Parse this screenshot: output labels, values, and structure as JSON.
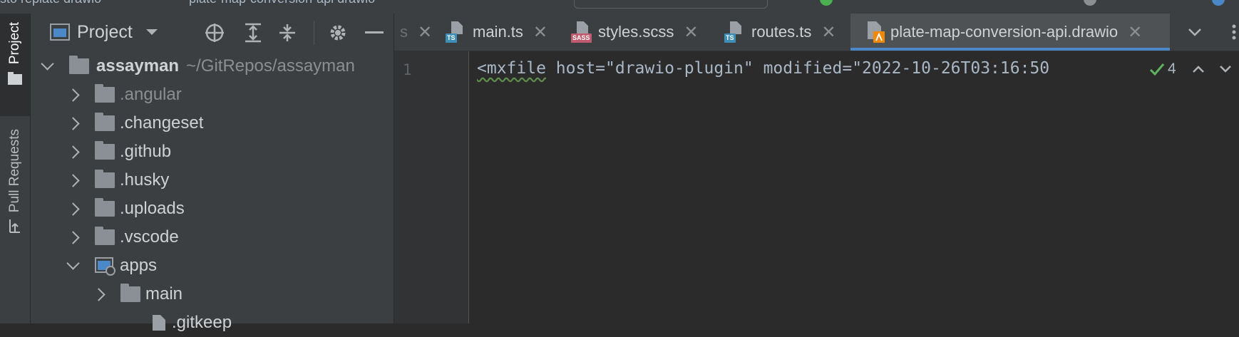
{
  "toolbar": {
    "crumbs": [
      "sto  replate drawio",
      "plate-map-conversion-api drawio"
    ]
  },
  "tool_strip": {
    "project": "Project",
    "pull_requests": "Pull Requests"
  },
  "project_panel": {
    "title": "Project",
    "tree": [
      {
        "label": "assayman",
        "hint": "~/GitRepos/assayman",
        "expanded": true,
        "depth": 0,
        "kind": "folder"
      },
      {
        "label": ".angular",
        "expanded": false,
        "depth": 1,
        "kind": "folder",
        "dim": true
      },
      {
        "label": ".changeset",
        "expanded": false,
        "depth": 1,
        "kind": "folder"
      },
      {
        "label": ".github",
        "expanded": false,
        "depth": 1,
        "kind": "folder"
      },
      {
        "label": ".husky",
        "expanded": false,
        "depth": 1,
        "kind": "folder"
      },
      {
        "label": ".uploads",
        "expanded": false,
        "depth": 1,
        "kind": "folder"
      },
      {
        "label": ".vscode",
        "expanded": false,
        "depth": 1,
        "kind": "folder"
      },
      {
        "label": "apps",
        "expanded": true,
        "depth": 1,
        "kind": "module"
      },
      {
        "label": "main",
        "expanded": false,
        "depth": 2,
        "kind": "folder"
      },
      {
        "label": ".gitkeep",
        "depth": 2,
        "kind": "file"
      }
    ]
  },
  "tabs": [
    {
      "label": "s",
      "type": "",
      "active": false
    },
    {
      "label": "main.ts",
      "type": "TS",
      "active": false
    },
    {
      "label": "styles.scss",
      "type": "SASS",
      "active": false
    },
    {
      "label": "routes.ts",
      "type": "TS",
      "active": false
    },
    {
      "label": "plate-map-conversion-api.drawio",
      "type": "drawio",
      "active": true
    }
  ],
  "editor": {
    "line_number": "1",
    "code_tag": "<mxfile",
    "code_rest": " host=\"drawio-plugin\" modified=\"2022-10-26T03:16:50",
    "inspection_count": "4"
  },
  "colors": {
    "ts_badge": "#3d8fb7",
    "sass_badge": "#c05a6e",
    "accent": "#4a88c7",
    "check": "#5fb25f"
  }
}
